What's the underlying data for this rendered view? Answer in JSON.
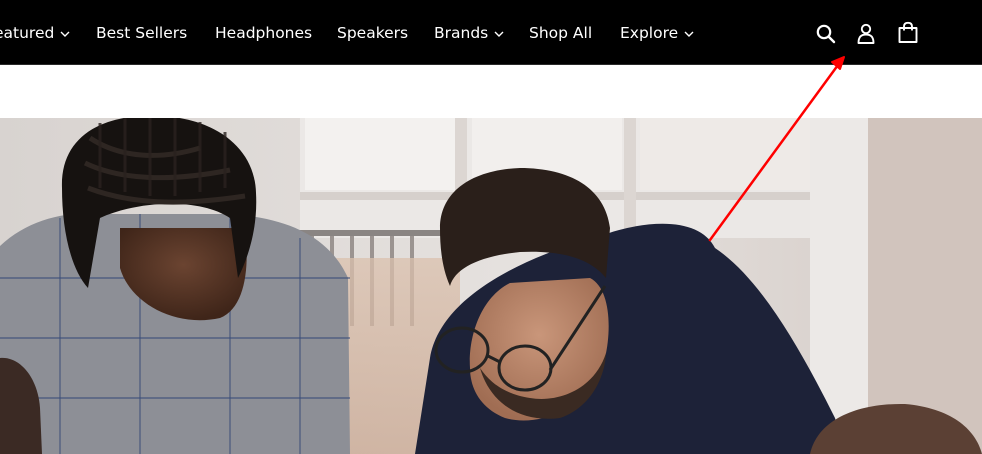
{
  "header": {
    "nav_items": [
      {
        "label": "eatured",
        "has_dropdown": true
      },
      {
        "label": "Best Sellers",
        "has_dropdown": false
      },
      {
        "label": "Headphones",
        "has_dropdown": false
      },
      {
        "label": "Speakers",
        "has_dropdown": false
      },
      {
        "label": "Brands",
        "has_dropdown": true
      },
      {
        "label": "Shop All",
        "has_dropdown": false
      },
      {
        "label": "Explore",
        "has_dropdown": true
      }
    ],
    "icons": {
      "search": "search-icon",
      "account": "account-icon",
      "cart": "cart-icon"
    }
  },
  "colors": {
    "nav_background": "#000000",
    "nav_text": "#ffffff",
    "annotation_arrow": "#ff0000"
  },
  "hero": {
    "image": "photo of people leaning over a table"
  }
}
